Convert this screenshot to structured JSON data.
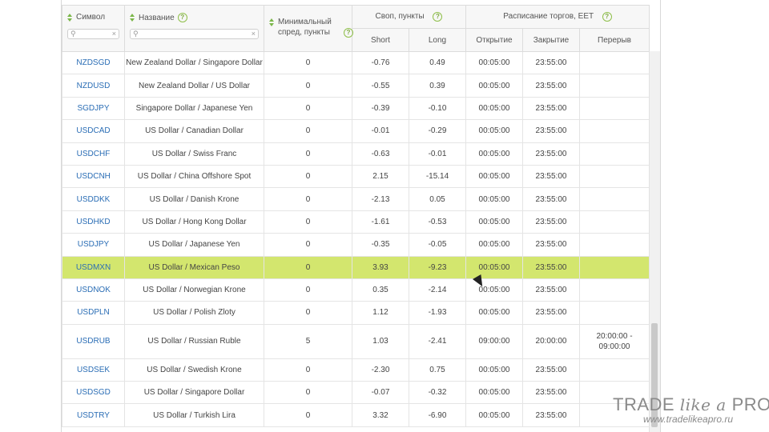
{
  "headers": {
    "symbol": "Символ",
    "name": "Название",
    "min_spread": "Минимальный спред, пункты",
    "swap_group": "Своп, пункты",
    "schedule_group": "Расписание торгов, EET",
    "short": "Short",
    "long": "Long",
    "open": "Открытие",
    "close": "Закрытие",
    "breaks": "Перерыв"
  },
  "rows": [
    {
      "symbol": "NZDSGD",
      "name": "New Zealand Dollar / Singapore Dollar",
      "spread": "0",
      "short": "-0.76",
      "long": "0.49",
      "open": "00:05:00",
      "close": "23:55:00",
      "breaks": ""
    },
    {
      "symbol": "NZDUSD",
      "name": "New Zealand Dollar / US Dollar",
      "spread": "0",
      "short": "-0.55",
      "long": "0.39",
      "open": "00:05:00",
      "close": "23:55:00",
      "breaks": ""
    },
    {
      "symbol": "SGDJPY",
      "name": "Singapore Dollar / Japanese Yen",
      "spread": "0",
      "short": "-0.39",
      "long": "-0.10",
      "open": "00:05:00",
      "close": "23:55:00",
      "breaks": ""
    },
    {
      "symbol": "USDCAD",
      "name": "US Dollar / Canadian Dollar",
      "spread": "0",
      "short": "-0.01",
      "long": "-0.29",
      "open": "00:05:00",
      "close": "23:55:00",
      "breaks": ""
    },
    {
      "symbol": "USDCHF",
      "name": "US Dollar / Swiss Franc",
      "spread": "0",
      "short": "-0.63",
      "long": "-0.01",
      "open": "00:05:00",
      "close": "23:55:00",
      "breaks": ""
    },
    {
      "symbol": "USDCNH",
      "name": "US Dollar / China Offshore Spot",
      "spread": "0",
      "short": "2.15",
      "long": "-15.14",
      "open": "00:05:00",
      "close": "23:55:00",
      "breaks": ""
    },
    {
      "symbol": "USDDKK",
      "name": "US Dollar / Danish Krone",
      "spread": "0",
      "short": "-2.13",
      "long": "0.05",
      "open": "00:05:00",
      "close": "23:55:00",
      "breaks": ""
    },
    {
      "symbol": "USDHKD",
      "name": "US Dollar / Hong Kong Dollar",
      "spread": "0",
      "short": "-1.61",
      "long": "-0.53",
      "open": "00:05:00",
      "close": "23:55:00",
      "breaks": ""
    },
    {
      "symbol": "USDJPY",
      "name": "US Dollar / Japanese Yen",
      "spread": "0",
      "short": "-0.35",
      "long": "-0.05",
      "open": "00:05:00",
      "close": "23:55:00",
      "breaks": ""
    },
    {
      "symbol": "USDMXN",
      "name": "US Dollar / Mexican Peso",
      "spread": "0",
      "short": "3.93",
      "long": "-9.23",
      "open": "00:05:00",
      "close": "23:55:00",
      "breaks": "",
      "highlight": true
    },
    {
      "symbol": "USDNOK",
      "name": "US Dollar / Norwegian Krone",
      "spread": "0",
      "short": "0.35",
      "long": "-2.14",
      "open": "00:05:00",
      "close": "23:55:00",
      "breaks": ""
    },
    {
      "symbol": "USDPLN",
      "name": "US Dollar / Polish Zloty",
      "spread": "0",
      "short": "1.12",
      "long": "-1.93",
      "open": "00:05:00",
      "close": "23:55:00",
      "breaks": ""
    },
    {
      "symbol": "USDRUB",
      "name": "US Dollar / Russian Ruble",
      "spread": "5",
      "short": "1.03",
      "long": "-2.41",
      "open": "09:00:00",
      "close": "20:00:00",
      "breaks": "20:00:00 -\n09:00:00"
    },
    {
      "symbol": "USDSEK",
      "name": "US Dollar / Swedish Krone",
      "spread": "0",
      "short": "-2.30",
      "long": "0.75",
      "open": "00:05:00",
      "close": "23:55:00",
      "breaks": ""
    },
    {
      "symbol": "USDSGD",
      "name": "US Dollar / Singapore Dollar",
      "spread": "0",
      "short": "-0.07",
      "long": "-0.32",
      "open": "00:05:00",
      "close": "23:55:00",
      "breaks": ""
    },
    {
      "symbol": "USDTRY",
      "name": "US Dollar / Turkish Lira",
      "spread": "0",
      "short": "3.32",
      "long": "-6.90",
      "open": "00:05:00",
      "close": "23:55:00",
      "breaks": ""
    }
  ],
  "watermark": {
    "trade": "TRADE ",
    "like": "like",
    "a": " a ",
    "pro": "PRO",
    "url": "www.tradelikeapro.ru"
  },
  "colors": {
    "highlight": "#d3e66e",
    "link": "#2a6db5",
    "accent": "#7ab648"
  }
}
